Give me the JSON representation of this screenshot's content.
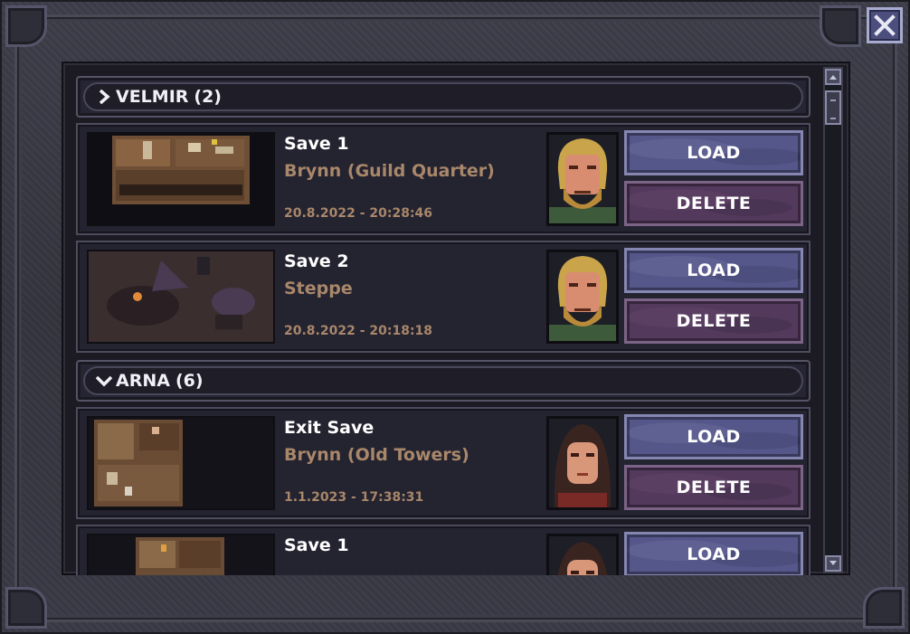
{
  "window": {
    "close_label": "Close"
  },
  "groups": [
    {
      "name": "VELMIR",
      "count": "(2)",
      "expanded": false,
      "saves": [
        {
          "name": "Save 1",
          "location": "Brynn (Guild Quarter)",
          "date": "20.8.2022 - 20:28:46",
          "portrait": "blond-bearded-man"
        },
        {
          "name": "Save 2",
          "location": "Steppe",
          "date": "20.8.2022 - 20:18:18",
          "portrait": "blond-bearded-man"
        }
      ]
    },
    {
      "name": "ARNA",
      "count": "(6)",
      "expanded": true,
      "saves": [
        {
          "name": "Exit Save",
          "location": "Brynn (Old Towers)",
          "date": "1.1.2023 - 17:38:31",
          "portrait": "dark-haired-woman"
        },
        {
          "name": "Save 1",
          "location": "",
          "date": "",
          "portrait": "dark-haired-woman"
        }
      ]
    }
  ],
  "buttons": {
    "load": "LOAD",
    "delete": "DELETE"
  },
  "colors": {
    "load_button": "#55578a",
    "delete_button": "#533a5c",
    "location_text": "#a8876a",
    "panel_bg": "#1c1b24"
  },
  "icons": {
    "collapsed": "chevron-right-icon",
    "expanded": "chevron-down-icon",
    "close": "close-icon"
  }
}
